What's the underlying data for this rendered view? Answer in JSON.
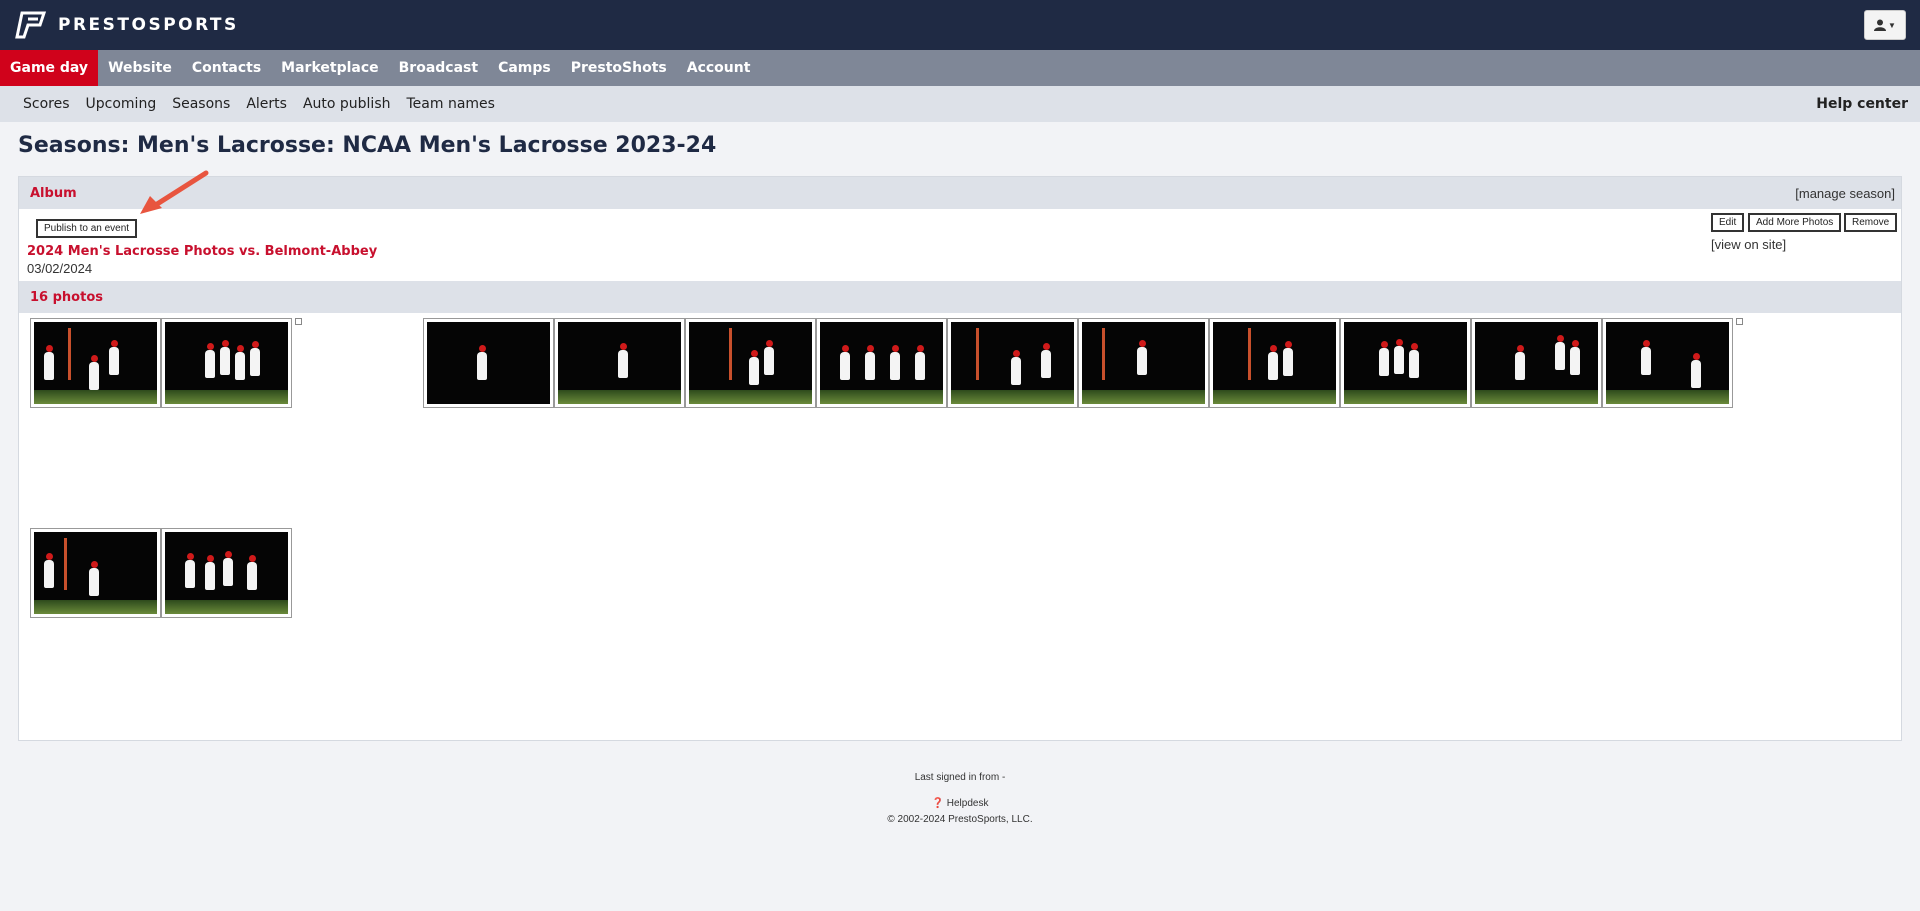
{
  "brand": {
    "name": "PRESTOSPORTS"
  },
  "main_nav": [
    "Game day",
    "Website",
    "Contacts",
    "Marketplace",
    "Broadcast",
    "Camps",
    "PrestoShots",
    "Account"
  ],
  "sub_nav": [
    "Scores",
    "Upcoming",
    "Seasons",
    "Alerts",
    "Auto publish",
    "Team names"
  ],
  "help_center": "Help center",
  "page_title": "Seasons: Men's Lacrosse: NCAA Men's Lacrosse 2023-24",
  "album_panel": {
    "title": "Album",
    "manage_link": "[manage season]",
    "publish_button": "Publish to an event",
    "album_name": "2024 Men's Lacrosse Photos vs. Belmont-Abbey",
    "album_date": "03/02/2024",
    "edit_button": "Edit",
    "add_more_button": "Add More Photos",
    "remove_button": "Remove",
    "view_link": "[view on site]"
  },
  "photo_count": "16 photos",
  "colors": {
    "header_bg": "#1f2a44",
    "nav_bg": "#7f8797",
    "active_red": "#d0021b",
    "accent_red": "#c8102e",
    "subnav_bg": "#dde1e8",
    "annotation_arrow": "#e8553f"
  },
  "footer": {
    "last_signed": "Last signed in from -",
    "helpdesk": "Helpdesk",
    "copyright": "© 2002-2024 PrestoSports, LLC."
  }
}
